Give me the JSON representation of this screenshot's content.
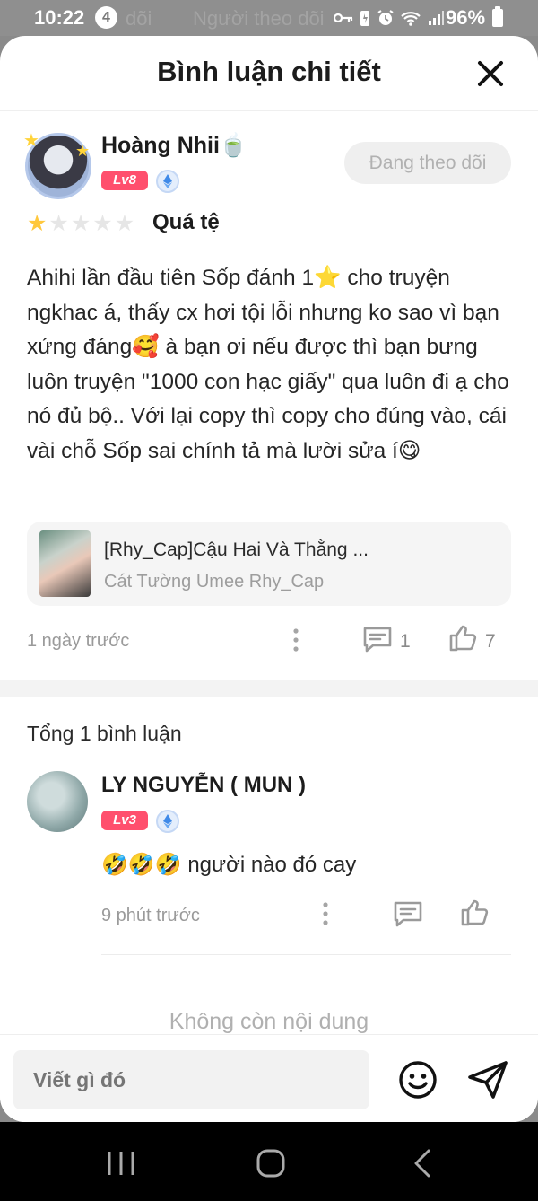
{
  "status_bar": {
    "time": "10:22",
    "notification_count": "4",
    "battery": "96%",
    "ghost_text_left": "dõi",
    "ghost_text_right": "Người theo dõi"
  },
  "header": {
    "title": "Bình luận chi tiết"
  },
  "review": {
    "username": "Hoàng Nhii🍵",
    "level": "Lv8",
    "follow_label": "Đang theo dõi",
    "rating_stars_filled": 1,
    "rating_stars_total": 5,
    "rating_label": "Quá tệ",
    "text": "Ahihi lần đầu tiên Sốp đánh 1⭐ cho truyện ngkhac á, thấy cx hơi tội lỗi nhưng ko sao vì bạn xứng đáng🥰 à bạn ơi nếu được thì bạn bưng luôn truyện \"1000 con hạc giấy\" qua luôn đi ạ cho nó đủ bộ.. Với lại copy thì copy cho đúng vào, cái  vài chỗ Sốp sai chính tả mà lười sửa í😋",
    "book": {
      "title": "[Rhy_Cap]Cậu Hai Và Thằng ...",
      "author": "Cát Tường Umee Rhy_Cap"
    },
    "time": "1 ngày trước",
    "comment_count": "1",
    "like_count": "7"
  },
  "replies": {
    "total_label": "Tổng 1 bình luận",
    "items": [
      {
        "username": "LY NGUYỄN ( MUN )",
        "level": "Lv3",
        "text": "🤣🤣🤣 người nào đó cay",
        "time": "9 phút trước"
      }
    ],
    "end_label": "Không còn nội dung"
  },
  "input": {
    "placeholder": "Viết gì đó"
  },
  "colors": {
    "level_badge": "#ff4f6d",
    "star": "#ffc83d",
    "star_empty": "#e6e6e6",
    "muted": "#9a9a9a"
  }
}
